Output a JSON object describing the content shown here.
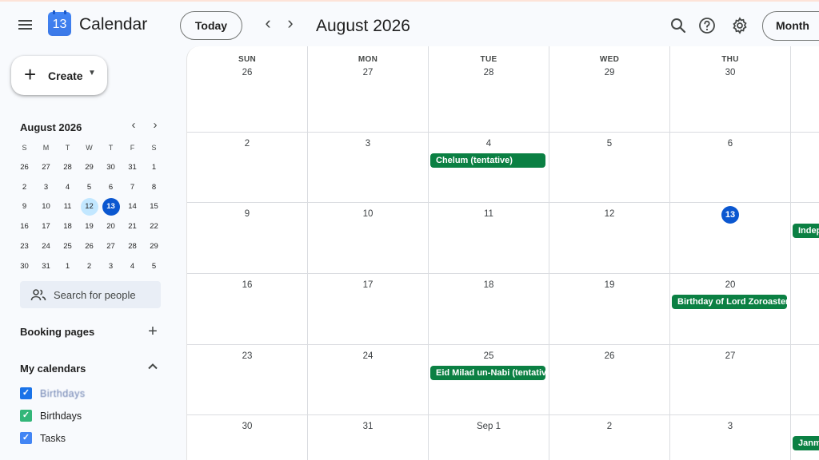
{
  "app": {
    "title": "Calendar",
    "logo_number": "13"
  },
  "header": {
    "today_label": "Today",
    "prev_label": "‹",
    "next_label": "›",
    "period_title": "August 2026",
    "view_label": "Month",
    "icons": [
      "search-icon",
      "help-icon",
      "settings-icon"
    ]
  },
  "sidebar": {
    "create_label": "Create",
    "mini_calendar": {
      "title": "August 2026",
      "weekday_headers": [
        "S",
        "M",
        "T",
        "W",
        "T",
        "F",
        "S"
      ],
      "weeks": [
        [
          "26",
          "27",
          "28",
          "29",
          "30",
          "31",
          "1"
        ],
        [
          "2",
          "3",
          "4",
          "5",
          "6",
          "7",
          "8"
        ],
        [
          "9",
          "10",
          "11",
          "12",
          "13",
          "14",
          "15"
        ],
        [
          "16",
          "17",
          "18",
          "19",
          "20",
          "21",
          "22"
        ],
        [
          "23",
          "24",
          "25",
          "26",
          "27",
          "28",
          "29"
        ],
        [
          "30",
          "31",
          "1",
          "2",
          "3",
          "4",
          "5"
        ]
      ],
      "selected_day": "12",
      "today_day": "13"
    },
    "people_search_placeholder": "Search for people",
    "booking_pages_label": "Booking pages",
    "my_calendars_label": "My calendars",
    "calendars": [
      {
        "label": "Birthdays",
        "color": "#1a73e8",
        "checked": true,
        "obscured": true
      },
      {
        "label": "Birthdays",
        "color": "#33b679",
        "checked": true
      },
      {
        "label": "Tasks",
        "color": "#4285f4",
        "checked": true
      }
    ]
  },
  "month_grid": {
    "weekday_headers": [
      "SUN",
      "MON",
      "TUE",
      "WED",
      "THU"
    ],
    "weeks": [
      [
        "26",
        "27",
        "28",
        "29",
        "30"
      ],
      [
        "2",
        "3",
        "4",
        "5",
        "6"
      ],
      [
        "9",
        "10",
        "11",
        "12",
        "13"
      ],
      [
        "16",
        "17",
        "18",
        "19",
        "20"
      ],
      [
        "23",
        "24",
        "25",
        "26",
        "27"
      ],
      [
        "30",
        "31",
        "Sep 1",
        "2",
        "3"
      ]
    ],
    "today": {
      "week": 2,
      "day": 4
    },
    "events": [
      {
        "week": 1,
        "day": 2,
        "title": "Chelum (tentative)"
      },
      {
        "week": 2,
        "day": 5,
        "title": "Indep"
      },
      {
        "week": 3,
        "day": 4,
        "title": "Birthday of Lord Zoroaster"
      },
      {
        "week": 4,
        "day": 2,
        "title": "Eid Milad un-Nabi (tentative)"
      },
      {
        "week": 5,
        "day": 5,
        "title": "Janm"
      }
    ],
    "event_color": "#0b8043"
  }
}
